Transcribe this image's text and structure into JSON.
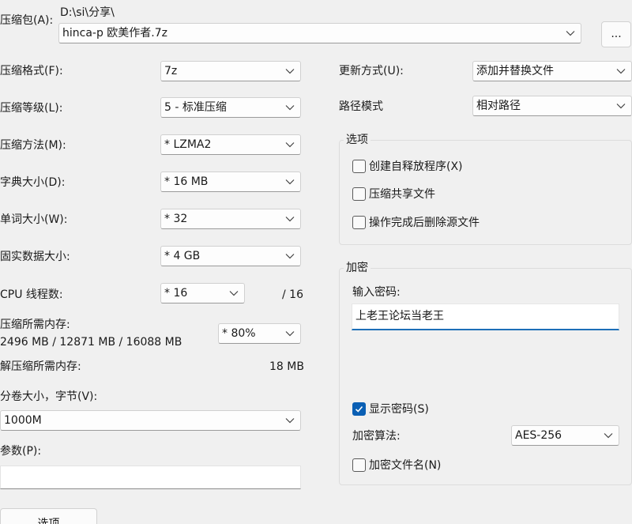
{
  "archive": {
    "label": "压缩包(A):",
    "path": "D:\\si\\分享\\",
    "filename": "hinca-p 欧美作者.7z",
    "browse_label": "..."
  },
  "left": {
    "format_label": "压缩格式(F):",
    "format_value": "7z",
    "level_label": "压缩等级(L):",
    "level_value": "5 - 标准压缩",
    "method_label": "压缩方法(M):",
    "method_value": "* LZMA2",
    "dict_label": "字典大小(D):",
    "dict_value": "* 16 MB",
    "word_label": "单词大小(W):",
    "word_value": "* 32",
    "solid_label": "固实数据大小:",
    "solid_value": "* 4 GB",
    "threads_label": "CPU 线程数:",
    "threads_value": "* 16",
    "threads_max": "/ 16",
    "mem_comp_label": "压缩所需内存:",
    "mem_comp_value": "2496 MB / 12871 MB / 16088 MB",
    "mem_percent": "* 80%",
    "mem_decomp_label": "解压缩所需内存:",
    "mem_decomp_value": "18 MB",
    "volume_label": "分卷大小，字节(V):",
    "volume_value": "1000M",
    "params_label": "参数(P):",
    "params_value": "",
    "options_button": "选项"
  },
  "right": {
    "update_label": "更新方式(U):",
    "update_value": "添加并替换文件",
    "pathmode_label": "路径模式",
    "pathmode_value": "相对路径",
    "options_group": {
      "title": "选项",
      "sfx": "创建自释放程序(X)",
      "shared": "压缩共享文件",
      "delete": "操作完成后删除源文件"
    },
    "encryption_group": {
      "title": "加密",
      "password_label": "输入密码:",
      "password_value": "上老王论坛当老王",
      "show_password": "显示密码(S)",
      "method_label": "加密算法:",
      "method_value": "AES-256",
      "encrypt_names": "加密文件名(N)"
    }
  },
  "checks": {
    "sfx": false,
    "shared": false,
    "delete": false,
    "show_password": true,
    "encrypt_names": false
  },
  "colors": {
    "accent": "#0a5fb4",
    "background": "#f0f0f0"
  }
}
